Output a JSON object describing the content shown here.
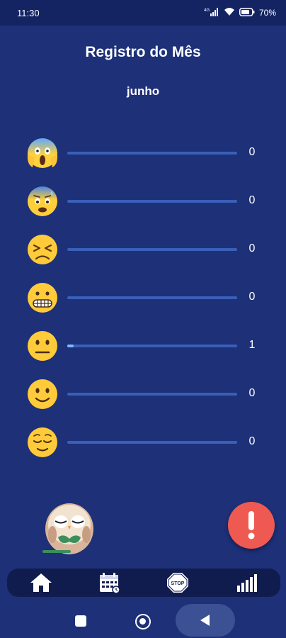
{
  "status_bar": {
    "time": "11:30",
    "network": "4G",
    "battery": "70"
  },
  "header": {
    "title": "Registro do Mês",
    "month": "junho"
  },
  "moods": [
    {
      "icon": "screaming-face-icon",
      "count": "0",
      "level": 0
    },
    {
      "icon": "anxious-face-icon",
      "count": "0",
      "level": 0
    },
    {
      "icon": "persevering-face-icon",
      "count": "0",
      "level": 0
    },
    {
      "icon": "grimacing-face-icon",
      "count": "0",
      "level": 0
    },
    {
      "icon": "neutral-face-icon",
      "count": "1",
      "level": 0.04
    },
    {
      "icon": "slightly-smiling-face-icon",
      "count": "0",
      "level": 0
    },
    {
      "icon": "relieved-face-icon",
      "count": "0",
      "level": 0
    }
  ],
  "nav": [
    {
      "icon": "home-icon"
    },
    {
      "icon": "calendar-icon"
    },
    {
      "icon": "stop-sign-icon"
    },
    {
      "icon": "bar-chart-icon"
    }
  ],
  "colors": {
    "background": "#1d3078",
    "alert": "#ee5a52",
    "track": "#3a5fb8",
    "fill": "#7fb6ff"
  }
}
